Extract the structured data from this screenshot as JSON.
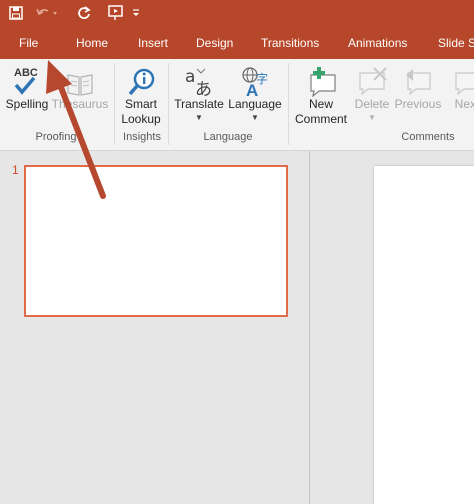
{
  "colors": {
    "accent": "#b7472a",
    "ribbon": "#f3f3f3",
    "thumb_border": "#e06a4a",
    "annotation_arrow": "#b5482e"
  },
  "quick_access": {
    "icons": [
      "save-icon",
      "undo-icon",
      "redo-icon",
      "start-from-beginning-icon",
      "customize-qat-icon"
    ]
  },
  "tabs": [
    {
      "label": "File"
    },
    {
      "label": "Home"
    },
    {
      "label": "Insert"
    },
    {
      "label": "Design"
    },
    {
      "label": "Transitions"
    },
    {
      "label": "Animations"
    },
    {
      "label": "Slide Sh"
    }
  ],
  "ribbon": {
    "proofing": {
      "group_label": "Proofing",
      "spelling_label": "Spelling",
      "spelling_icon_text": "ABC",
      "thesaurus_label": "Thesaurus"
    },
    "insights": {
      "group_label": "Insights",
      "smart_lookup_line1": "Smart",
      "smart_lookup_line2": "Lookup"
    },
    "language": {
      "group_label": "Language",
      "translate_label": "Translate",
      "language_label": "Language"
    },
    "comments": {
      "group_label": "Comments",
      "new_comment_line1": "New",
      "new_comment_line2": "Comment",
      "delete_label": "Delete",
      "previous_label": "Previous",
      "next_label": "Next"
    }
  },
  "slides": [
    {
      "number": "1"
    }
  ]
}
